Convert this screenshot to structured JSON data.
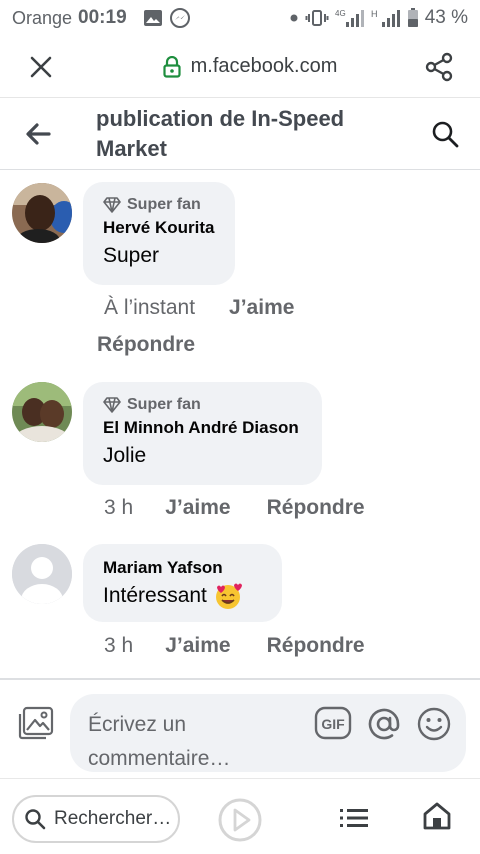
{
  "status_bar": {
    "carrier": "Orange",
    "time": "00:19",
    "network_type": "4G",
    "network_h": "H",
    "battery": "43 %"
  },
  "browser": {
    "url": "m.facebook.com"
  },
  "header": {
    "title_line1": "publication de In-Speed",
    "title_line2": "Market"
  },
  "comments": [
    {
      "badge": "Super fan",
      "author": "Hervé Kourita",
      "text": "Super",
      "time": "À l’instant",
      "like": "J’aime",
      "reply": "Répondre"
    },
    {
      "badge": "Super fan",
      "author": "El Minnoh André Diason",
      "text": "Jolie",
      "time": "3 h",
      "like": "J’aime",
      "reply": "Répondre"
    },
    {
      "badge": "",
      "author": "Mariam Yafson",
      "text": "Intéressant",
      "emoji": "smiling-face-with-hearts-icon",
      "time": "3 h",
      "like": "J’aime",
      "reply": "Répondre"
    }
  ],
  "composer": {
    "placeholder_line1": "Écrivez un",
    "placeholder_line2": "commentaire…",
    "gif_label": "GIF"
  },
  "bottom_bar": {
    "search_text": "Rechercher…"
  },
  "colors": {
    "bubble": "#f0f2f5",
    "text_secondary": "#65676b",
    "lock_green": "#1e8e3e"
  }
}
